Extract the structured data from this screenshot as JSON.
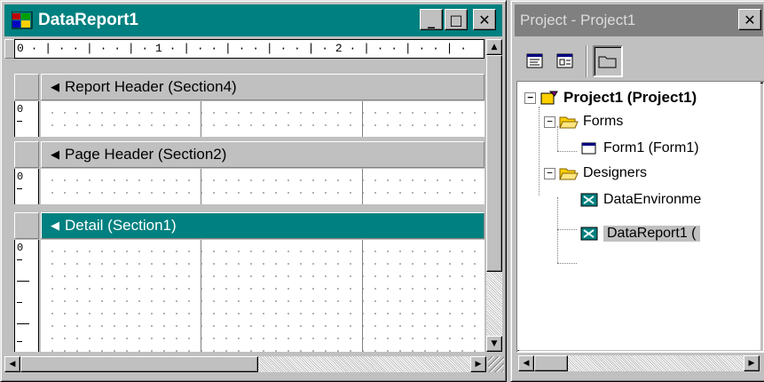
{
  "report_window": {
    "title": "DataReport1",
    "ruler_text": "0 · | · · | · · | · 1 · | · · | · · | · · | · 2 · | · · | · · | ·",
    "vruler_zero": "0",
    "sections": [
      {
        "label": "Report Header (Section4)",
        "selected": false
      },
      {
        "label": "Page Header (Section2)",
        "selected": false
      },
      {
        "label": "Detail (Section1)",
        "selected": true
      }
    ],
    "minimize_glyph": "_",
    "maximize_glyph": "□",
    "close_glyph": "✕"
  },
  "project_window": {
    "title": "Project - Project1",
    "close_glyph": "✕",
    "toolbar": [
      "view-code-icon",
      "view-object-icon",
      "toggle-folders-icon"
    ],
    "tree": {
      "root": "Project1 (Project1)",
      "forms_folder": "Forms",
      "form1": "Form1 (Form1)",
      "designers_folder": "Designers",
      "dataenv": "DataEnvironme",
      "datareport": "DataReport1 ("
    }
  },
  "colors": {
    "titlebar_active": "#008080",
    "titlebar_inactive": "#808080",
    "selection": "#c0c0c0"
  }
}
